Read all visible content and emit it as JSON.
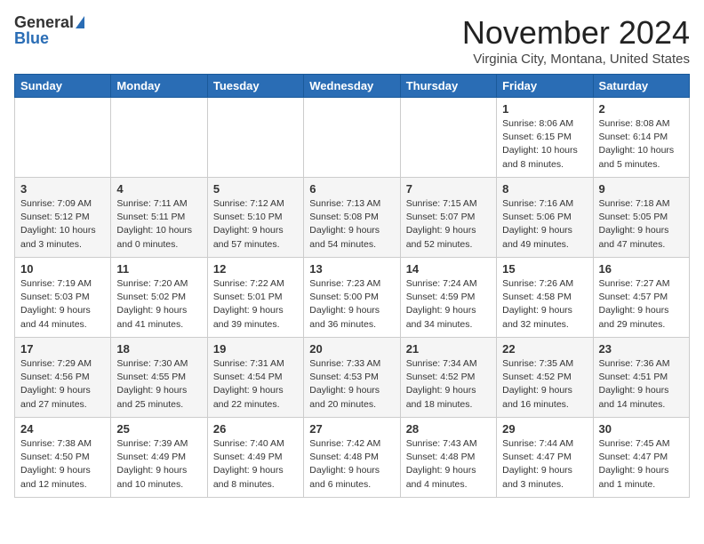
{
  "header": {
    "logo_general": "General",
    "logo_blue": "Blue",
    "month_title": "November 2024",
    "location": "Virginia City, Montana, United States"
  },
  "days_of_week": [
    "Sunday",
    "Monday",
    "Tuesday",
    "Wednesday",
    "Thursday",
    "Friday",
    "Saturday"
  ],
  "weeks": [
    [
      {
        "day": "",
        "info": ""
      },
      {
        "day": "",
        "info": ""
      },
      {
        "day": "",
        "info": ""
      },
      {
        "day": "",
        "info": ""
      },
      {
        "day": "",
        "info": ""
      },
      {
        "day": "1",
        "info": "Sunrise: 8:06 AM\nSunset: 6:15 PM\nDaylight: 10 hours\nand 8 minutes."
      },
      {
        "day": "2",
        "info": "Sunrise: 8:08 AM\nSunset: 6:14 PM\nDaylight: 10 hours\nand 5 minutes."
      }
    ],
    [
      {
        "day": "3",
        "info": "Sunrise: 7:09 AM\nSunset: 5:12 PM\nDaylight: 10 hours\nand 3 minutes."
      },
      {
        "day": "4",
        "info": "Sunrise: 7:11 AM\nSunset: 5:11 PM\nDaylight: 10 hours\nand 0 minutes."
      },
      {
        "day": "5",
        "info": "Sunrise: 7:12 AM\nSunset: 5:10 PM\nDaylight: 9 hours\nand 57 minutes."
      },
      {
        "day": "6",
        "info": "Sunrise: 7:13 AM\nSunset: 5:08 PM\nDaylight: 9 hours\nand 54 minutes."
      },
      {
        "day": "7",
        "info": "Sunrise: 7:15 AM\nSunset: 5:07 PM\nDaylight: 9 hours\nand 52 minutes."
      },
      {
        "day": "8",
        "info": "Sunrise: 7:16 AM\nSunset: 5:06 PM\nDaylight: 9 hours\nand 49 minutes."
      },
      {
        "day": "9",
        "info": "Sunrise: 7:18 AM\nSunset: 5:05 PM\nDaylight: 9 hours\nand 47 minutes."
      }
    ],
    [
      {
        "day": "10",
        "info": "Sunrise: 7:19 AM\nSunset: 5:03 PM\nDaylight: 9 hours\nand 44 minutes."
      },
      {
        "day": "11",
        "info": "Sunrise: 7:20 AM\nSunset: 5:02 PM\nDaylight: 9 hours\nand 41 minutes."
      },
      {
        "day": "12",
        "info": "Sunrise: 7:22 AM\nSunset: 5:01 PM\nDaylight: 9 hours\nand 39 minutes."
      },
      {
        "day": "13",
        "info": "Sunrise: 7:23 AM\nSunset: 5:00 PM\nDaylight: 9 hours\nand 36 minutes."
      },
      {
        "day": "14",
        "info": "Sunrise: 7:24 AM\nSunset: 4:59 PM\nDaylight: 9 hours\nand 34 minutes."
      },
      {
        "day": "15",
        "info": "Sunrise: 7:26 AM\nSunset: 4:58 PM\nDaylight: 9 hours\nand 32 minutes."
      },
      {
        "day": "16",
        "info": "Sunrise: 7:27 AM\nSunset: 4:57 PM\nDaylight: 9 hours\nand 29 minutes."
      }
    ],
    [
      {
        "day": "17",
        "info": "Sunrise: 7:29 AM\nSunset: 4:56 PM\nDaylight: 9 hours\nand 27 minutes."
      },
      {
        "day": "18",
        "info": "Sunrise: 7:30 AM\nSunset: 4:55 PM\nDaylight: 9 hours\nand 25 minutes."
      },
      {
        "day": "19",
        "info": "Sunrise: 7:31 AM\nSunset: 4:54 PM\nDaylight: 9 hours\nand 22 minutes."
      },
      {
        "day": "20",
        "info": "Sunrise: 7:33 AM\nSunset: 4:53 PM\nDaylight: 9 hours\nand 20 minutes."
      },
      {
        "day": "21",
        "info": "Sunrise: 7:34 AM\nSunset: 4:52 PM\nDaylight: 9 hours\nand 18 minutes."
      },
      {
        "day": "22",
        "info": "Sunrise: 7:35 AM\nSunset: 4:52 PM\nDaylight: 9 hours\nand 16 minutes."
      },
      {
        "day": "23",
        "info": "Sunrise: 7:36 AM\nSunset: 4:51 PM\nDaylight: 9 hours\nand 14 minutes."
      }
    ],
    [
      {
        "day": "24",
        "info": "Sunrise: 7:38 AM\nSunset: 4:50 PM\nDaylight: 9 hours\nand 12 minutes."
      },
      {
        "day": "25",
        "info": "Sunrise: 7:39 AM\nSunset: 4:49 PM\nDaylight: 9 hours\nand 10 minutes."
      },
      {
        "day": "26",
        "info": "Sunrise: 7:40 AM\nSunset: 4:49 PM\nDaylight: 9 hours\nand 8 minutes."
      },
      {
        "day": "27",
        "info": "Sunrise: 7:42 AM\nSunset: 4:48 PM\nDaylight: 9 hours\nand 6 minutes."
      },
      {
        "day": "28",
        "info": "Sunrise: 7:43 AM\nSunset: 4:48 PM\nDaylight: 9 hours\nand 4 minutes."
      },
      {
        "day": "29",
        "info": "Sunrise: 7:44 AM\nSunset: 4:47 PM\nDaylight: 9 hours\nand 3 minutes."
      },
      {
        "day": "30",
        "info": "Sunrise: 7:45 AM\nSunset: 4:47 PM\nDaylight: 9 hours\nand 1 minute."
      }
    ]
  ]
}
